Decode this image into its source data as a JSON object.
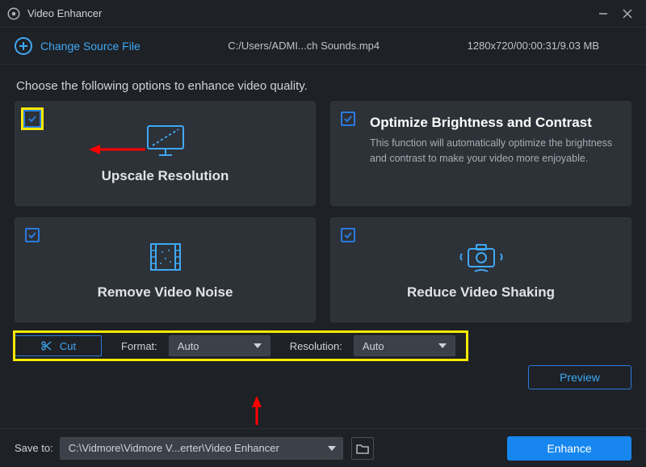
{
  "titlebar": {
    "title": "Video Enhancer"
  },
  "sourcebar": {
    "change_label": "Change Source File",
    "path": "C:/Users/ADMI...ch Sounds.mp4",
    "meta": "1280x720/00:00:31/9.03 MB"
  },
  "instruction": "Choose the following options to enhance video quality.",
  "cards": {
    "upscale": {
      "title": "Upscale Resolution"
    },
    "optimize": {
      "title": "Optimize Brightness and Contrast",
      "desc": "This function will automatically optimize the brightness and contrast to make your video more enjoyable."
    },
    "noise": {
      "title": "Remove Video Noise"
    },
    "shaking": {
      "title": "Reduce Video Shaking"
    }
  },
  "controls": {
    "cut_label": "Cut",
    "format_label": "Format:",
    "format_value": "Auto",
    "resolution_label": "Resolution:",
    "resolution_value": "Auto",
    "preview_label": "Preview"
  },
  "bottom": {
    "save_label": "Save to:",
    "save_path": "C:\\Vidmore\\Vidmore V...erter\\Video Enhancer",
    "enhance_label": "Enhance"
  },
  "colors": {
    "accent": "#1786ef",
    "highlight": "#f7ea00"
  }
}
